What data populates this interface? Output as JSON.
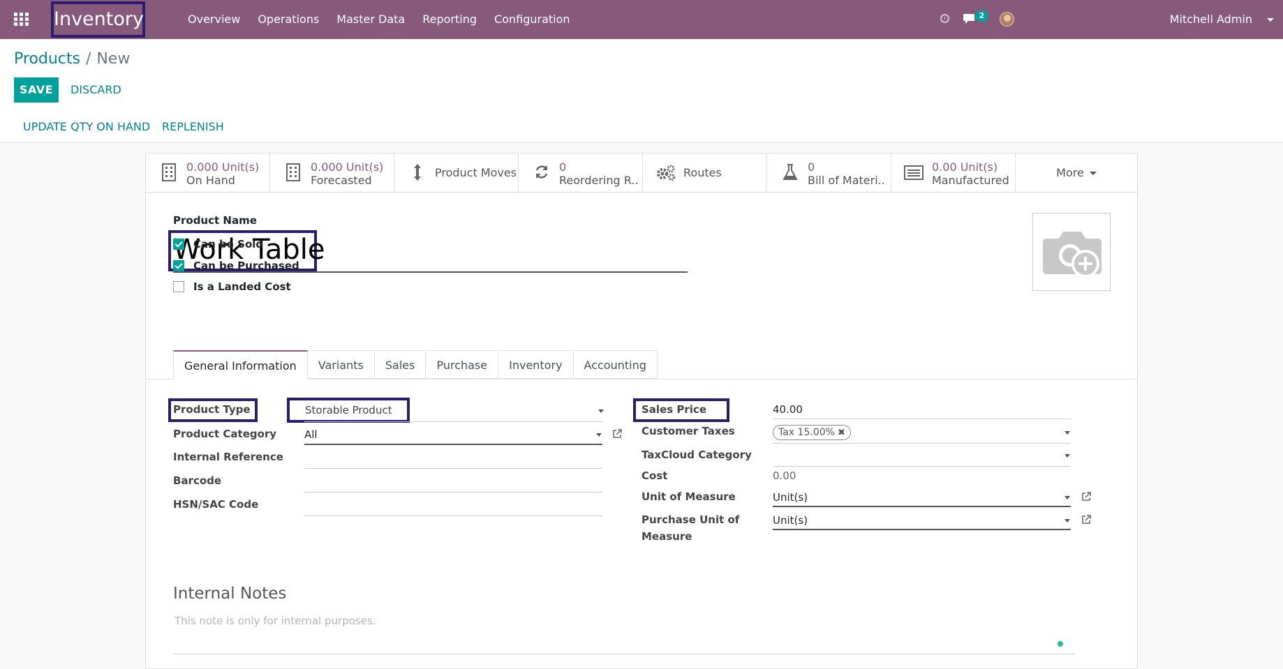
{
  "nav": {
    "brand": "Inventory",
    "menu": [
      "Overview",
      "Operations",
      "Master Data",
      "Reporting",
      "Configuration"
    ],
    "chat_count": "2",
    "user": "Mitchell Admin"
  },
  "control": {
    "breadcrumb_parent": "Products",
    "breadcrumb_sep": "/",
    "breadcrumb_current": "New",
    "save_label": "SAVE",
    "discard_label": "DISCARD"
  },
  "actions": {
    "update_qty": "UPDATE QTY ON HAND",
    "replenish": "REPLENISH"
  },
  "stats": {
    "on_hand_value": "0.000 Unit(s)",
    "on_hand_label": "On Hand",
    "forecasted_value": "0.000 Unit(s)",
    "forecasted_label": "Forecasted",
    "moves_label": "Product Moves",
    "reorder_value": "0",
    "reorder_label": "Reordering R...",
    "routes_label": "Routes",
    "bom_value": "0",
    "bom_label": "Bill of Materi...",
    "manufactured_value": "0.00 Unit(s)",
    "manufactured_label": "Manufactured",
    "more_label": "More"
  },
  "product": {
    "name_label": "Product Name",
    "name": "Work Table",
    "can_be_sold": "Can be Sold",
    "can_be_purchased": "Can be Purchased",
    "is_landed_cost": "Is a Landed Cost"
  },
  "tabs": [
    "General Information",
    "Variants",
    "Sales",
    "Purchase",
    "Inventory",
    "Accounting"
  ],
  "left_fields": {
    "product_type_label": "Product Type",
    "product_type": "Storable Product",
    "category_label": "Product Category",
    "category": "All",
    "internal_ref_label": "Internal Reference",
    "barcode_label": "Barcode",
    "hsn_label": "HSN/SAC Code"
  },
  "right_fields": {
    "sales_price_label": "Sales Price",
    "sales_price": "40.00",
    "customer_taxes_label": "Customer Taxes",
    "customer_tax_tag": "Tax 15.00%",
    "taxcloud_label": "TaxCloud Category",
    "cost_label": "Cost",
    "cost": "0.00",
    "uom_label": "Unit of Measure",
    "uom": "Unit(s)",
    "purchase_uom_label_1": "Purchase Unit of",
    "purchase_uom_label_2": "Measure",
    "purchase_uom": "Unit(s)"
  },
  "notes": {
    "title": "Internal Notes",
    "placeholder": "This note is only for internal purposes."
  },
  "colors": {
    "brand": "#875a7b",
    "accent": "#00a09d",
    "highlight": "#2a1c6e"
  }
}
